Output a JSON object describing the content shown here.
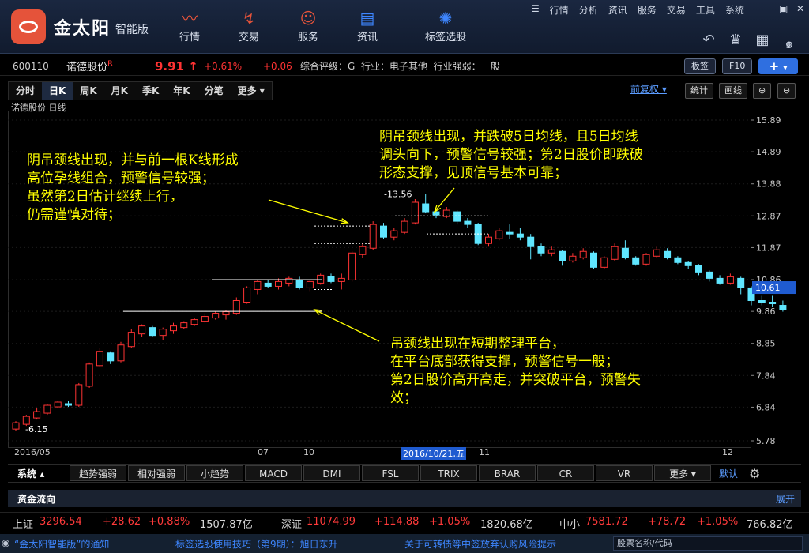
{
  "app": {
    "logo_text": "金太阳",
    "logo_sub": "智能版"
  },
  "nav": [
    {
      "label": "行情",
      "icon": "trend-icon"
    },
    {
      "label": "交易",
      "icon": "trade-icon"
    },
    {
      "label": "服务",
      "icon": "user-icon"
    },
    {
      "label": "资讯",
      "icon": "news-icon"
    },
    {
      "label": "标签选股",
      "icon": "bulb-icon"
    }
  ],
  "menu": [
    "行情",
    "分析",
    "资讯",
    "服务",
    "交易",
    "工具",
    "系统"
  ],
  "stock": {
    "code": "600110",
    "name": "诺德股份",
    "badge": "R",
    "price": "9.91",
    "arrow": "↑",
    "pct": "+0.61%",
    "chg": "+0.06",
    "rating": "综合评级：G",
    "industry": "行业：电子其他",
    "strength": "行业强弱：一般"
  },
  "buttons": {
    "board": "板签",
    "f10": "F10",
    "plus": "+",
    "adjust": "前复权",
    "stats": "统计",
    "draw": "画线"
  },
  "periods": [
    "分时",
    "日K",
    "周K",
    "月K",
    "季K",
    "年K",
    "分笔",
    "更多"
  ],
  "chart_label": "诺德股份  日线",
  "chart_data": {
    "type": "candlestick",
    "title": "诺德股份 日线",
    "y_ticks": [
      "15.89",
      "14.89",
      "13.88",
      "12.87",
      "11.87",
      "10.86",
      "9.86",
      "8.85",
      "7.84",
      "6.84",
      "5.78"
    ],
    "ylim": [
      5.78,
      15.89
    ],
    "current_price_label": "10.61",
    "high_label": "13.56",
    "low_label": "6.15",
    "candles": [
      [
        6.15,
        6.35,
        6.1,
        6.4
      ],
      [
        6.3,
        6.55,
        6.25,
        6.6
      ],
      [
        6.5,
        6.7,
        6.45,
        6.8
      ],
      [
        6.65,
        6.9,
        6.6,
        6.95
      ],
      [
        6.85,
        7.0,
        6.8,
        7.05
      ],
      [
        6.95,
        6.9,
        6.85,
        7.05
      ],
      [
        6.9,
        7.55,
        6.85,
        7.6
      ],
      [
        7.5,
        8.2,
        7.45,
        8.25
      ],
      [
        8.15,
        8.6,
        8.1,
        8.7
      ],
      [
        8.55,
        8.3,
        8.2,
        8.6
      ],
      [
        8.3,
        8.8,
        8.25,
        8.9
      ],
      [
        8.75,
        9.2,
        8.7,
        9.3
      ],
      [
        9.15,
        9.4,
        9.05,
        9.45
      ],
      [
        9.35,
        9.1,
        9.05,
        9.4
      ],
      [
        9.1,
        9.3,
        8.95,
        9.35
      ],
      [
        9.25,
        9.4,
        9.15,
        9.5
      ],
      [
        9.35,
        9.5,
        9.3,
        9.55
      ],
      [
        9.45,
        9.6,
        9.4,
        9.65
      ],
      [
        9.55,
        9.7,
        9.5,
        9.8
      ],
      [
        9.65,
        9.8,
        9.6,
        9.85
      ],
      [
        9.75,
        9.85,
        9.6,
        9.9
      ],
      [
        9.8,
        10.2,
        9.75,
        10.3
      ],
      [
        10.15,
        10.6,
        10.1,
        10.65
      ],
      [
        10.55,
        10.8,
        10.4,
        10.85
      ],
      [
        10.75,
        10.65,
        10.6,
        10.85
      ],
      [
        10.65,
        10.8,
        10.55,
        10.9
      ],
      [
        10.75,
        10.9,
        10.65,
        10.95
      ],
      [
        10.85,
        10.6,
        10.55,
        10.95
      ],
      [
        10.6,
        10.8,
        10.5,
        10.85
      ],
      [
        10.75,
        11.0,
        10.7,
        11.05
      ],
      [
        10.95,
        10.8,
        10.75,
        11.05
      ],
      [
        10.8,
        10.9,
        10.55,
        11.05
      ],
      [
        10.85,
        11.7,
        10.8,
        11.75
      ],
      [
        11.65,
        11.9,
        11.55,
        12.0
      ],
      [
        11.85,
        12.6,
        11.8,
        12.7
      ],
      [
        12.55,
        12.2,
        12.15,
        12.65
      ],
      [
        12.2,
        12.4,
        12.1,
        12.5
      ],
      [
        12.35,
        12.7,
        12.3,
        12.8
      ],
      [
        12.65,
        13.3,
        12.6,
        13.4
      ],
      [
        13.25,
        13.0,
        12.95,
        13.56
      ],
      [
        13.0,
        12.9,
        12.8,
        13.1
      ],
      [
        12.85,
        13.05,
        12.8,
        13.15
      ],
      [
        13.0,
        12.7,
        12.6,
        13.05
      ],
      [
        12.7,
        12.6,
        12.5,
        12.8
      ],
      [
        12.6,
        12.0,
        11.95,
        12.65
      ],
      [
        12.0,
        12.2,
        11.9,
        12.3
      ],
      [
        12.15,
        12.4,
        12.1,
        12.5
      ],
      [
        12.35,
        12.3,
        12.15,
        12.6
      ],
      [
        12.3,
        12.2,
        12.1,
        12.5
      ],
      [
        12.2,
        11.9,
        11.5,
        12.3
      ],
      [
        11.9,
        11.7,
        11.6,
        12.0
      ],
      [
        11.7,
        11.8,
        11.6,
        11.9
      ],
      [
        11.75,
        11.45,
        11.3,
        11.8
      ],
      [
        11.45,
        11.6,
        11.4,
        11.7
      ],
      [
        11.55,
        11.75,
        11.5,
        11.85
      ],
      [
        11.7,
        11.25,
        11.2,
        11.75
      ],
      [
        11.25,
        11.55,
        11.2,
        11.6
      ],
      [
        11.5,
        11.9,
        11.45,
        12.0
      ],
      [
        11.85,
        11.55,
        11.5,
        12.1
      ],
      [
        11.55,
        11.35,
        11.3,
        11.6
      ],
      [
        11.35,
        11.65,
        11.3,
        11.7
      ],
      [
        11.6,
        11.8,
        11.55,
        11.9
      ],
      [
        11.75,
        11.55,
        11.5,
        11.85
      ],
      [
        11.55,
        11.4,
        11.35,
        11.6
      ],
      [
        11.4,
        11.3,
        11.2,
        11.45
      ],
      [
        11.3,
        11.1,
        11.0,
        11.35
      ],
      [
        11.1,
        10.9,
        10.8,
        11.15
      ],
      [
        10.9,
        10.75,
        10.7,
        11.0
      ],
      [
        10.75,
        10.95,
        10.7,
        11.05
      ],
      [
        10.9,
        10.6,
        10.4,
        10.95
      ],
      [
        10.6,
        10.2,
        10.05,
        10.65
      ],
      [
        10.2,
        10.15,
        10.05,
        10.35
      ],
      [
        10.15,
        10.1,
        10.0,
        10.35
      ],
      [
        10.05,
        9.91,
        9.85,
        10.2
      ]
    ],
    "x_ticks": [
      "2016/05",
      "07",
      "10",
      "2016/10/21,五",
      "11",
      "12"
    ]
  },
  "annotations": [
    [
      "阴吊颈线出现，并与前一根K线形成",
      "高位孕线组合，预警信号较强；",
      "虽然第2日估计继续上行，",
      "仍需谨慎对待；"
    ],
    [
      "阴吊颈线出现，并跌破5日均线，且5日均线",
      "调头向下，预警信号较强；第2日股价即跌破",
      "形态支撑，见顶信号基本可靠；"
    ],
    [
      "吊颈线出现在短期整理平台，",
      "在平台底部获得支撑，预警信号一般；",
      "第2日股价高开高走，并突破平台，预警失",
      "效；"
    ]
  ],
  "indicators": {
    "system_label": "系统",
    "tabs": [
      "趋势强弱",
      "相对强弱",
      "小趋势",
      "MACD",
      "DMI",
      "FSL",
      "TRIX",
      "BRAR",
      "CR",
      "VR",
      "更多"
    ],
    "default_label": "默认"
  },
  "money_flow": {
    "title": "资金流向",
    "expand": "展开"
  },
  "indices": [
    {
      "name": "上证",
      "value": "3296.54",
      "chg": "+28.62",
      "pct": "+0.88%",
      "amount": "1507.87亿"
    },
    {
      "name": "深证",
      "value": "11074.99",
      "chg": "+114.88",
      "pct": "+1.05%",
      "amount": "1820.68亿"
    },
    {
      "name": "中小",
      "value": "7581.72",
      "chg": "+78.72",
      "pct": "+1.05%",
      "amount": "766.82亿"
    }
  ],
  "status": {
    "notice": "“金太阳智能版”的通知",
    "tip": "标签选股使用技巧（第9期）：旭日东升",
    "risk": "关于可转债等中签放弃认购风险提示",
    "search_placeholder": "股票名称/代码"
  },
  "colors": {
    "up": "#ff3333",
    "down": "#5fe6ff",
    "annotation": "#ffff00",
    "accent": "#e5533a"
  }
}
